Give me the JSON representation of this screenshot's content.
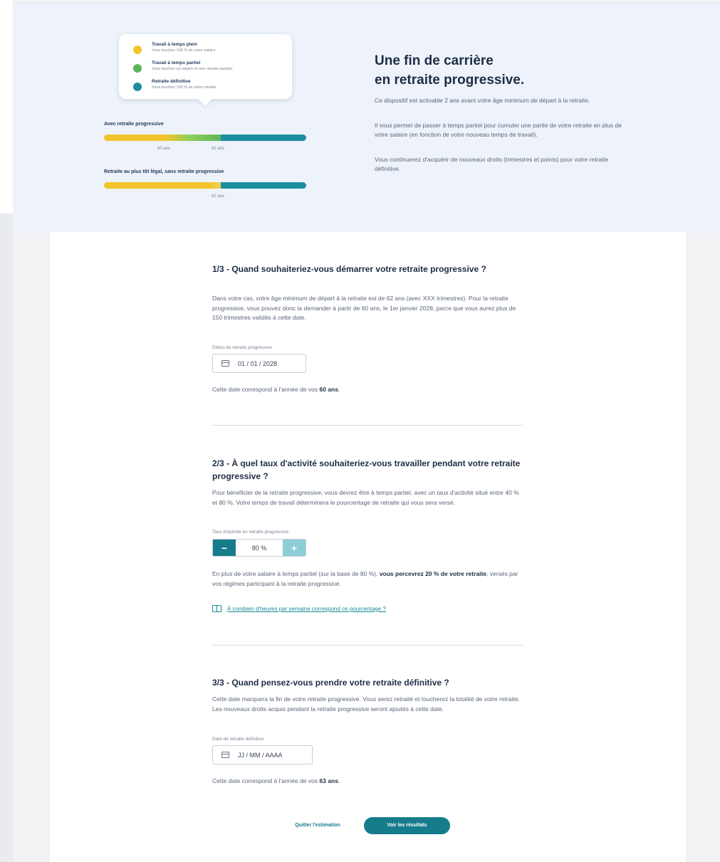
{
  "colors": {
    "yellow": "#f2c42c",
    "green": "#5bb55b",
    "teal": "#1d8ea0",
    "accent": "#167c8c"
  },
  "legend": {
    "items": [
      {
        "title": "Travail à temps plein",
        "subtitle": "Vous touchez 100 % de votre salaire.",
        "color": "#f2c42c"
      },
      {
        "title": "Travail à temps partiel",
        "subtitle": "Vous touchez un salaire et une retraite partiels.",
        "color": "#5bb55b"
      },
      {
        "title": "Retraite définitive",
        "subtitle": "Vous touchez 100 % de votre retraite.",
        "color": "#1d8ea0"
      }
    ]
  },
  "timeline": {
    "with_label": "Avec retraite progressive",
    "with_ticks": [
      "60 ans",
      "62 ans"
    ],
    "without_label": "Retraite au plus tôt légal, sans retraite progressive",
    "without_ticks": [
      "62 ans"
    ]
  },
  "intro": {
    "title_line1": "Une fin de carrière",
    "title_line2": "en retraite progressive.",
    "p1": "Ce dispositif est activable 2 ans avant votre âge minimum de départ à la retraite.",
    "p2": "Il vous permet de passer à temps partiel pour cumuler une partie de votre retraite en plus de votre salaire (en fonction de votre nouveau temps de travail).",
    "p3": "Vous continuerez d'acquérir de nouveaux droits (trimestres et points) pour votre retraite définitive."
  },
  "q1": {
    "title": "1/3 - Quand souhaiteriez-vous démarrer votre retraite progressive ?",
    "text": "Dans votre cas, votre âge minimum de départ à la retraite est de 62 ans (avec XXX trimestres). Pour la retraite progressive, vous pouvez donc la demander à partir de 60 ans, le 1er janvier 2028, parce que vous aurez plus de 150 trimestres validés à cette date.",
    "field_label": "Début de retraite progressive",
    "value": "01 / 01 / 2028",
    "note_prefix": "Cette date correspond à l'année de vos ",
    "note_bold": "60 ans",
    "note_suffix": "."
  },
  "q2": {
    "title": "2/3 - À quel taux d'activité souhaiteriez-vous travailler pendant votre retraite progressive ?",
    "text": "Pour bénéficier de la retraite progressive, vous devrez être à temps partiel, avec un taux d'activité situé entre 40 % et 80 %. Votre temps de travail déterminera le pourcentage de retraite qui vous sera versé.",
    "field_label": "Taux d'activité en retraite progressive",
    "minus": "−",
    "value": "80 %",
    "plus": "+",
    "note_a": "En plus de votre salaire à temps partiel (sur la base de 80 %), ",
    "note_b": "vous percevrez 20 % de votre retraite",
    "note_c": ", versés par vos régimes participant à la retraite progressive.",
    "help_link": "À combien d'heures par semaine correspond ce pourcentage ?"
  },
  "q3": {
    "title": "3/3 - Quand pensez-vous prendre votre retraite définitive ?",
    "text": "Cette date marquera la fin de votre retraite progressive. Vous serez retraité et toucherez la totalité de votre retraite. Les nouveaux droits acquis pendant la retraite progressive seront ajoutés à cette date.",
    "field_label": "Date de retraite définitive",
    "placeholder": "JJ / MM / AAAA",
    "note_prefix": "Cette date correspond à l'année de vos ",
    "note_bold": "63 ans",
    "note_suffix": "."
  },
  "actions": {
    "quit": "Quitter l'estimation",
    "results": "Voir les résultats"
  }
}
